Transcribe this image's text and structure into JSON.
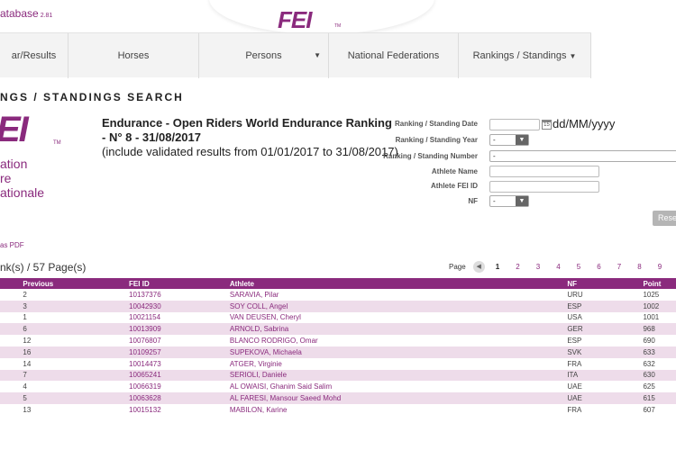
{
  "header": {
    "db_title": "atabase",
    "db_version": "2.81",
    "logo": "FEI",
    "logo_tm": "TM"
  },
  "nav": [
    {
      "label": "ar/Results",
      "chevron": false
    },
    {
      "label": "Horses",
      "chevron": false
    },
    {
      "label": "Persons",
      "chevron": true
    },
    {
      "label": "National Federations",
      "chevron": false
    },
    {
      "label": "Rankings / Standings",
      "chevron": true
    }
  ],
  "section_title": "NGS / STANDINGS SEARCH",
  "side_logo": {
    "big": "EI",
    "tm": "TM",
    "line1": "ation",
    "line2": "re",
    "line3": "ationale"
  },
  "ranking": {
    "title_line1": "Endurance - Open Riders World Endurance Ranking",
    "title_line2": "- N° 8 - 31/08/2017",
    "subtitle": "(include validated results from 01/01/2017 to 31/08/2017)"
  },
  "form": {
    "date_label": "Ranking / Standing Date",
    "date_value": "",
    "date_format": "dd/MM/yyyy",
    "year_label": "Ranking / Standing Year",
    "year_value": "-",
    "number_label": "Ranking / Standing Number",
    "number_value": "-",
    "athlete_name_label": "Athlete Name",
    "athlete_id_label": "Athlete FEI ID",
    "nf_label": "NF",
    "nf_value": "-",
    "reset_label": "Rese"
  },
  "export_pdf": "as PDF",
  "page_count": "nk(s) / 57 Page(s)",
  "pager": {
    "label": "Page",
    "pages": [
      "1",
      "2",
      "3",
      "4",
      "5",
      "6",
      "7",
      "8",
      "9"
    ],
    "current": "1"
  },
  "table": {
    "headers": [
      "",
      "Previous",
      "FEI ID",
      "Athlete",
      "NF",
      "Point"
    ],
    "rows": [
      {
        "previous": "2",
        "fei_id": "10137376",
        "athlete": "SARAVIA, Pilar",
        "nf": "URU",
        "points": "1025"
      },
      {
        "previous": "3",
        "fei_id": "10042930",
        "athlete": "SOY COLL, Angel",
        "nf": "ESP",
        "points": "1002"
      },
      {
        "previous": "1",
        "fei_id": "10021154",
        "athlete": "VAN DEUSEN, Cheryl",
        "nf": "USA",
        "points": "1001"
      },
      {
        "previous": "6",
        "fei_id": "10013909",
        "athlete": "ARNOLD, Sabrina",
        "nf": "GER",
        "points": "968"
      },
      {
        "previous": "12",
        "fei_id": "10076807",
        "athlete": "BLANCO RODRIGO, Omar",
        "nf": "ESP",
        "points": "690"
      },
      {
        "previous": "16",
        "fei_id": "10109257",
        "athlete": "SUPEKOVA, Michaela",
        "nf": "SVK",
        "points": "633"
      },
      {
        "previous": "14",
        "fei_id": "10014473",
        "athlete": "ATGER, Virginie",
        "nf": "FRA",
        "points": "632"
      },
      {
        "previous": "7",
        "fei_id": "10065241",
        "athlete": "SERIOLI, Daniele",
        "nf": "ITA",
        "points": "630"
      },
      {
        "previous": "4",
        "fei_id": "10066319",
        "athlete": "AL OWAISI, Ghanim Said Salim",
        "nf": "UAE",
        "points": "625"
      },
      {
        "previous": "5",
        "fei_id": "10063628",
        "athlete": "AL FARESI, Mansour Saeed Mohd",
        "nf": "UAE",
        "points": "615"
      },
      {
        "previous": "13",
        "fei_id": "10015132",
        "athlete": "MABILON, Karine",
        "nf": "FRA",
        "points": "607"
      }
    ]
  }
}
